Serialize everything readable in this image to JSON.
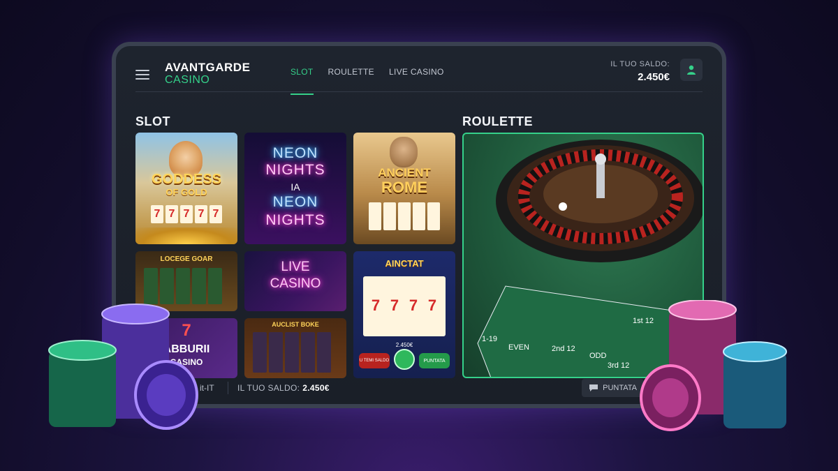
{
  "brand": {
    "line1": "AVANTGARDE",
    "line2": "CASINO"
  },
  "nav": [
    {
      "label": "SLOT",
      "active": true
    },
    {
      "label": "ROULETTE",
      "active": false
    },
    {
      "label": "LIVE CASINO",
      "active": false
    }
  ],
  "account": {
    "balance_label": "IL TUO SALDO:",
    "balance_value": "2.450€"
  },
  "sections": {
    "slot": "SLOT",
    "roulette": "ROULETTE"
  },
  "slots": [
    {
      "title_line1": "GODDESS",
      "title_line2": "OF GOLD",
      "reel_symbol": "7"
    },
    {
      "title_line1": "NEON",
      "title_line2": "NIGHTS",
      "title_line3": "IA",
      "title_line4": "NEON",
      "title_line5": "NIGHTS"
    },
    {
      "title_line1": "ANCIENT",
      "title_line2": "ROME"
    },
    {
      "title_line1": "LOCEGE GOAR"
    },
    {
      "title_line1": "LIVE",
      "title_line2": "CASINO"
    },
    {
      "title_line1": "AINCTAT",
      "reel_symbol": "7",
      "balance": "2.450€",
      "btn_left": "U TEMI SALDO",
      "btn_right": "PUNTATA"
    },
    {
      "title_line1": "7",
      "title_line2": "ABBURII",
      "title_line3": "CASINO"
    },
    {
      "title_line1": "AUCLIST BOKE"
    }
  ],
  "roulette_table": {
    "labels": [
      "1-19",
      "EVEN",
      "2nd 12",
      "3rd 12",
      "1st 12",
      "ODD"
    ]
  },
  "footer": {
    "locale": "it-IT",
    "balance_label": "IL TUO SALDO:",
    "balance_value": "2.450€",
    "bet_label": "PUNTATA"
  },
  "colors": {
    "accent": "#35d18a",
    "panel": "#1e242e",
    "background": "#120d2a"
  }
}
